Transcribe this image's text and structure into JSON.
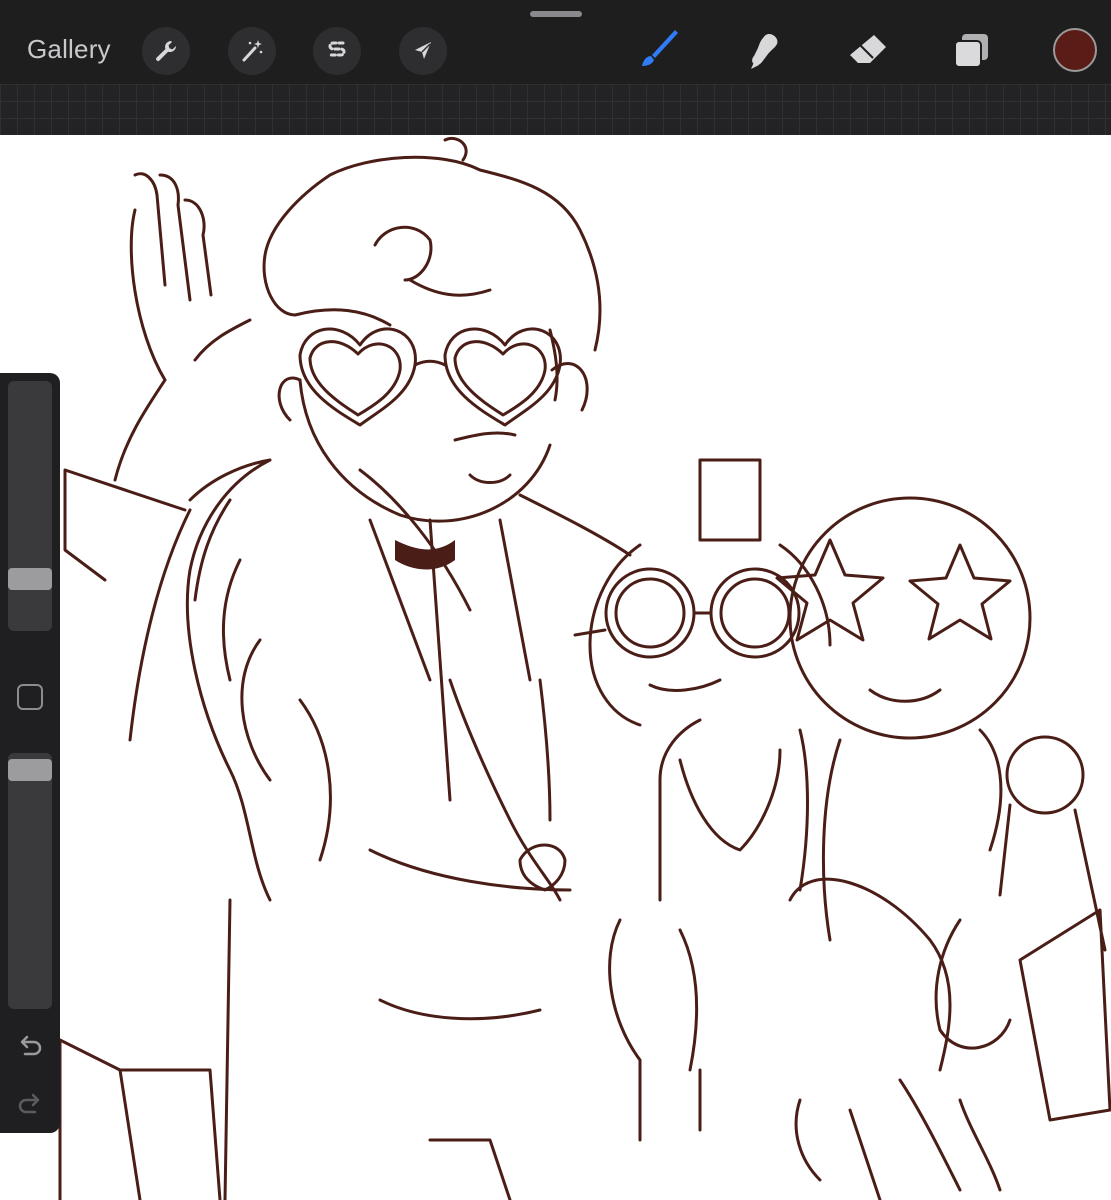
{
  "toolbar": {
    "gallery_label": "Gallery",
    "left_tools": [
      "wrench-icon",
      "magic-wand-icon",
      "selection-s-icon",
      "transform-arrow-icon"
    ],
    "right_tools": [
      "brush-icon",
      "smudge-icon",
      "eraser-icon",
      "layers-icon"
    ],
    "active_tool": "brush-icon",
    "active_tool_color": "#2f7cf6",
    "current_color": "#5a1c16"
  },
  "canvas": {
    "line_color": "#4a1e17"
  },
  "sidebar": {
    "brush_size_level": 0.76,
    "opacity_level": 0.05,
    "buttons": [
      "modify-square-icon",
      "undo-icon",
      "redo-icon"
    ]
  }
}
